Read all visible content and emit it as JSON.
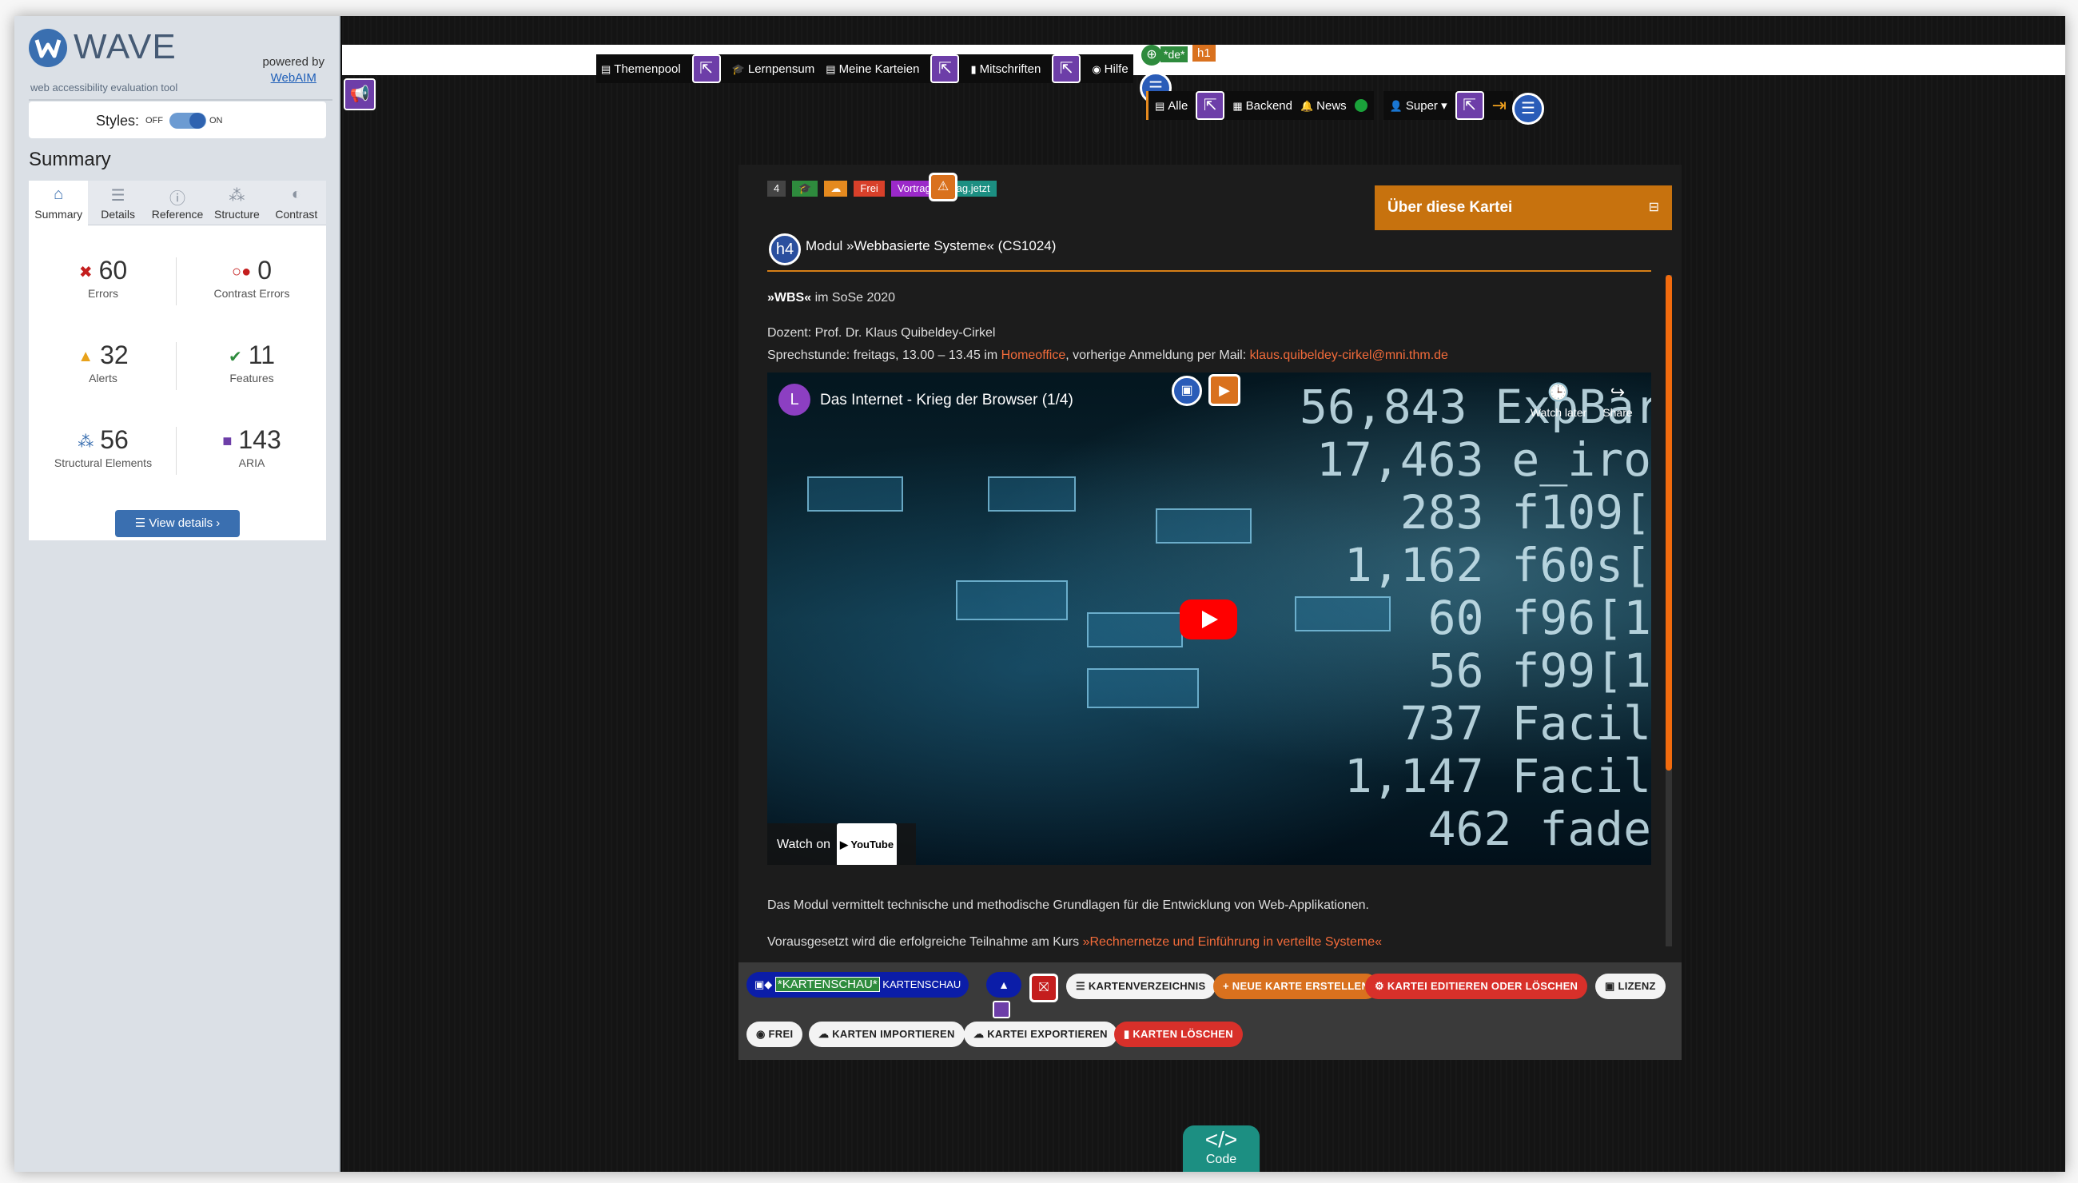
{
  "wave": {
    "name": "WAVE",
    "tagline": "web accessibility evaluation tool",
    "powered_by": "powered by",
    "powered_link": "WebAIM",
    "styles_label": "Styles:",
    "styles_off": "OFF",
    "styles_on": "ON",
    "summary_title": "Summary",
    "tabs": [
      {
        "label": "Summary",
        "icon": "home-icon",
        "glyph": "⌂"
      },
      {
        "label": "Details",
        "icon": "list-icon",
        "glyph": "☰"
      },
      {
        "label": "Reference",
        "icon": "info-icon",
        "glyph": "ⓘ"
      },
      {
        "label": "Structure",
        "icon": "structure-icon",
        "glyph": "⁂"
      },
      {
        "label": "Contrast",
        "icon": "contrast-icon",
        "glyph": "◐"
      }
    ],
    "stats": {
      "errors": {
        "value": "60",
        "label": "Errors",
        "color": "#c41e1e"
      },
      "contrast": {
        "value": "0",
        "label": "Contrast Errors",
        "color": "#c41e1e"
      },
      "alerts": {
        "value": "32",
        "label": "Alerts",
        "color": "#e8a21b"
      },
      "features": {
        "value": "11",
        "label": "Features",
        "color": "#2e8b3d"
      },
      "structural": {
        "value": "56",
        "label": "Structural Elements",
        "color": "#3a6fb0"
      },
      "aria": {
        "value": "143",
        "label": "ARIA",
        "color": "#6d3ea8"
      }
    },
    "view_details": "View details ›"
  },
  "site": {
    "topnav": [
      {
        "label": "Themenpool",
        "icon": "▤"
      },
      {
        "label": "Lernpensum",
        "icon": "🎓"
      },
      {
        "label": "Meine Karteien",
        "icon": "▤"
      },
      {
        "label": "Mitschriften",
        "icon": "▮"
      },
      {
        "label": "Hilfe",
        "icon": "◉"
      }
    ],
    "lang_badge": "*de*",
    "h1_badge": "h1",
    "subnav": {
      "alle": "Alle",
      "backend": "Backend",
      "news": "News",
      "super": "Super"
    },
    "card": {
      "badges": [
        {
          "text": "4",
          "color": "#444"
        },
        {
          "text": "🎓",
          "color": "#2e8b3d"
        },
        {
          "text": "☁",
          "color": "#e58a1f"
        },
        {
          "text": "Frei",
          "color": "#d8402a"
        },
        {
          "text": "Vortrag",
          "color": "#9b29c9"
        },
        {
          "text": "frag.jetzt",
          "color": "#1c8f82"
        }
      ],
      "about": "Über diese Kartei",
      "h4": "h4",
      "module_title": "Modul »Webbasierte Systeme« (CS1024)",
      "wbs_bold": "»WBS«",
      "wbs_rest": " im SoSe 2020",
      "lecturer": "Dozent: Prof. Dr. Klaus Quibeldey-Cirkel",
      "office_prefix": "Sprechstunde: freitags, 13.00 – 13.45 im ",
      "office_link": "Homeoffice",
      "office_mid": ", vorherige Anmeldung per Mail: ",
      "office_mail": "klaus.quibeldey-cirkel@mni.thm.de",
      "video": {
        "avatar": "L",
        "title": "Das Internet - Krieg der Browser (1/4)",
        "watch_later": "Watch later",
        "share": "Share",
        "watch_on": "Watch on",
        "youtube": "▶ YouTube",
        "numbers": "56,843 ExpBar\n17,463 e_iro\n  283 f109[\n1,162 f60s[\n   60 f96[1\n   56 f99[1\n  737 Facil\n1,147 Facil\n  462 fade"
      },
      "desc": "Das Modul vermittelt technische und methodische Grundlagen für die Entwicklung von Web-Applikationen.",
      "prereq_prefix": "Vorausgesetzt wird die erfolgreiche Teilnahme am Kurs ",
      "prereq_link": "»Rechnernetze und Einführung in verteilte Systeme«"
    },
    "toolbar": {
      "show_highlight": "*KARTENSCHAU*",
      "show_label": "KARTENSCHAU",
      "row1": [
        {
          "label": "☰ KARTENVERZEICHNIS",
          "style": "white"
        },
        {
          "label": "+ NEUE KARTE ERSTELLEN",
          "style": "orange"
        },
        {
          "label": "⚙ KARTEI EDITIEREN ODER LÖSCHEN",
          "style": "red"
        },
        {
          "label": "▣ LIZENZ",
          "style": "white"
        }
      ],
      "row2": [
        {
          "label": "◉ FREI",
          "style": "white"
        },
        {
          "label": "☁ KARTEN IMPORTIEREN",
          "style": "white"
        },
        {
          "label": "☁ KARTEI EXPORTIEREN",
          "style": "white"
        },
        {
          "label": "▮ KARTEN LÖSCHEN",
          "style": "red"
        }
      ]
    },
    "code_label": "Code",
    "code_glyph": "</>"
  }
}
